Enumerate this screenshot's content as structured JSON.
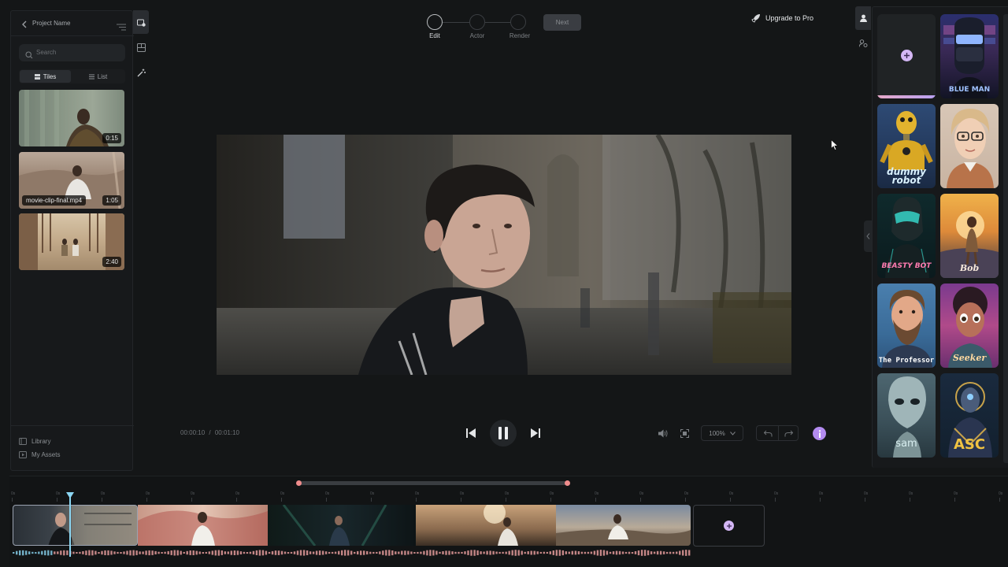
{
  "left_panel": {
    "project_name": "Project Name",
    "search_placeholder": "Search",
    "view_tiles": "Tiles",
    "view_list": "List",
    "media": [
      {
        "duration": "0:15",
        "name": ""
      },
      {
        "duration": "1:05",
        "name": "movie-clip-final.mp4"
      },
      {
        "duration": "2:40",
        "name": ""
      }
    ],
    "footer": {
      "library": "Library",
      "my_assets": "My Assets"
    }
  },
  "stepper": {
    "steps": [
      "Edit",
      "Actor",
      "Render"
    ],
    "active": "Edit",
    "next_label": "Next"
  },
  "header": {
    "upgrade_label": "Upgrade to Pro"
  },
  "player": {
    "current_time": "00:00:10",
    "separator": "/",
    "total_time": "00:01:10",
    "zoom": "100%"
  },
  "actors": [
    {
      "label": "",
      "art": "BLUE MAN"
    },
    {
      "label": "dummy robot",
      "art": ""
    },
    {
      "label": "",
      "art": ""
    },
    {
      "label": "BEASTY BOT",
      "art": ""
    },
    {
      "label": "Bob",
      "art": ""
    },
    {
      "label": "The Professor",
      "art": ""
    },
    {
      "label": "Seeker",
      "art": ""
    },
    {
      "label": "sam",
      "art": ""
    },
    {
      "label": "ASC",
      "art": ""
    }
  ],
  "timeline": {
    "tick_label": "0s",
    "playhead_fraction": 0.06
  },
  "colors": {
    "accent": "#c9a6ff",
    "playhead": "#8bd6f2",
    "waveform": "#f0a3a3"
  }
}
